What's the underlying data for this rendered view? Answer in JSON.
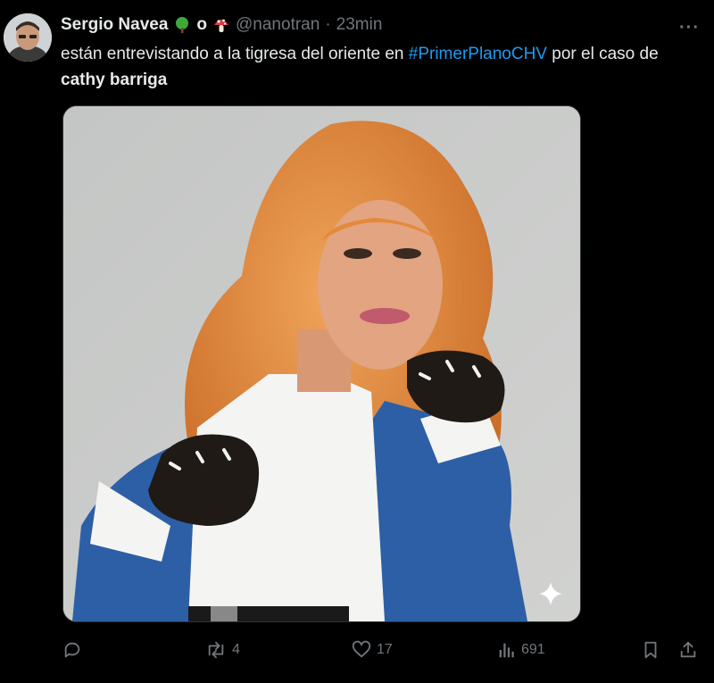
{
  "tweet": {
    "author_name": "Sergio Navea",
    "name_separator": "o",
    "handle": "@nanotran",
    "dot": "·",
    "time": "23min",
    "more_label": "···",
    "text_before": "están entrevistando a la tigresa del oriente en ",
    "hashtag": "#PrimerPlanoCHV",
    "text_middle": " por el caso de ",
    "bold_text": "cathy barriga",
    "emojis": [
      "tree-emoji",
      "mushroom-emoji"
    ]
  },
  "media": {
    "kind": "photo",
    "badge_icon": "sparkle-icon"
  },
  "actions": {
    "reply_count": "",
    "retweet_count": "4",
    "like_count": "17",
    "views_count": "691"
  },
  "colors": {
    "background": "#000000",
    "text": "#e7e9ea",
    "secondary": "#71767b",
    "link": "#1d9bf0"
  }
}
